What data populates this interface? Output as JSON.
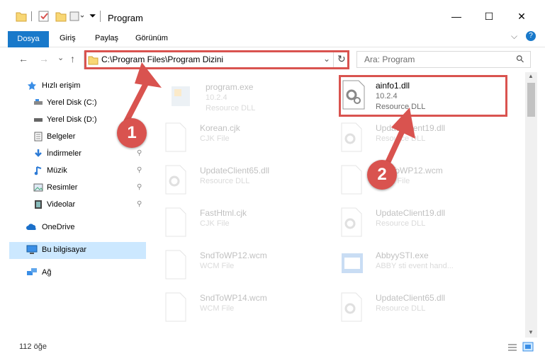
{
  "window": {
    "title": "Program",
    "minimize": "—",
    "maximize": "☐",
    "close": "✕"
  },
  "ribbon": {
    "tabs": [
      "Dosya",
      "Giriş",
      "Paylaş",
      "Görünüm"
    ],
    "collapse": "⌵",
    "help": "?"
  },
  "nav": {
    "back": "←",
    "forward": "→",
    "recent": "⌄",
    "up": "↑",
    "address": "C:\\Program Files\\Program Dizini",
    "dropdown": "⌄",
    "refresh": "↻",
    "search_placeholder": "Ara: Program",
    "search_icon": "⚲"
  },
  "sidebar": {
    "items": [
      {
        "label": "Hızlı erişim",
        "icon": "star-icon"
      },
      {
        "label": "Yerel Disk (C:)",
        "icon": "drive-icon"
      },
      {
        "label": "Yerel Disk (D:)",
        "icon": "drive-icon"
      },
      {
        "label": "Belgeler",
        "icon": "documents-icon"
      },
      {
        "label": "İndirmeler",
        "icon": "download-icon"
      },
      {
        "label": "Müzik",
        "icon": "music-icon"
      },
      {
        "label": "Resimler",
        "icon": "pictures-icon"
      },
      {
        "label": "Videolar",
        "icon": "videos-icon"
      },
      {
        "label": "OneDrive",
        "icon": "cloud-icon"
      },
      {
        "label": "Bu bilgisayar",
        "icon": "computer-icon"
      },
      {
        "label": "Ağ",
        "icon": "network-icon"
      }
    ],
    "pin": "📌"
  },
  "files": [
    {
      "name": "program.exe",
      "sub": "10.2.4",
      "type": "Resource DLL",
      "icon": "exe-icon"
    },
    {
      "name": "ainfo1.dll",
      "sub": "10.2.4",
      "type": "Resource DLL",
      "icon": "dll-icon"
    },
    {
      "name": "Korean.cjk",
      "sub": "CJK File",
      "type": "",
      "icon": "file-icon"
    },
    {
      "name": "UpdateClient19.dll",
      "sub": "Resource DLL",
      "type": "",
      "icon": "dll-icon"
    },
    {
      "name": "UpdateClient65.dll",
      "sub": "Resource DLL",
      "type": "",
      "icon": "dll-icon"
    },
    {
      "name": "SndToWP12.wcm",
      "sub": "WCM File",
      "type": "",
      "icon": "file-icon"
    },
    {
      "name": "FastHtml.cjk",
      "sub": "CJK File",
      "type": "",
      "icon": "file-icon"
    },
    {
      "name": "UpdateClient19.dll",
      "sub": "Resource DLL",
      "type": "",
      "icon": "dll-icon"
    },
    {
      "name": "SndToWP12.wcm",
      "sub": "WCM File",
      "type": "",
      "icon": "file-icon"
    },
    {
      "name": "AbbyySTI.exe",
      "sub": "ABBY sti event hand...",
      "type": "",
      "icon": "exe-icon"
    },
    {
      "name": "SndToWP14.wcm",
      "sub": "WCM File",
      "type": "",
      "icon": "file-icon"
    },
    {
      "name": "UpdateClient65.dll",
      "sub": "Resource DLL",
      "type": "",
      "icon": "dll-icon"
    }
  ],
  "status": {
    "count": "112 öğe"
  },
  "callouts": {
    "one": "1",
    "two": "2"
  },
  "colors": {
    "accent": "#1979ca",
    "highlight": "#d9534f",
    "selected": "#cce8ff"
  }
}
